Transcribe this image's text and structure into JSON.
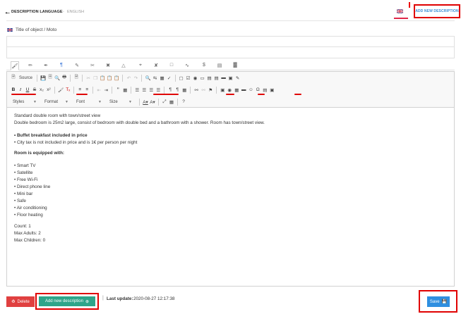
{
  "header": {
    "back_icon": "arrow-left-icon",
    "title": "DESCRIPTION LANGUAGE",
    "separator": "-",
    "language": "ENGLISH",
    "flag_icon": "uk-flag-icon",
    "add_new_label": "ADD NEW DESCRIPTION"
  },
  "title_field": {
    "label": "Title of object / Moto",
    "value": ""
  },
  "tabs": [
    {
      "icon": "paint-brush-icon",
      "active": true
    },
    {
      "icon": "pencil-icon"
    },
    {
      "icon": "pen-icon"
    },
    {
      "icon": "paragraph-icon"
    },
    {
      "icon": "marker-icon"
    },
    {
      "icon": "scissors-icon"
    },
    {
      "icon": "text-format-icon"
    },
    {
      "icon": "crop-icon"
    },
    {
      "icon": "draw-icon"
    },
    {
      "icon": "ruler-icon"
    },
    {
      "icon": "dollar-icon"
    },
    {
      "icon": "bed-icon"
    },
    {
      "icon": "align-icon"
    }
  ],
  "toolbar": {
    "source_label": "Source",
    "styles_label": "Styles",
    "format_label": "Format",
    "font_label": "Font",
    "size_label": "Size",
    "help_label": "?"
  },
  "content": {
    "line1": "Standard double room with town/street view",
    "line2": "Double bedroom is 25m2 large, consist of bedroom with double bed and a bathroom with a shower. Room has town/street view.",
    "breakfast": "• Buffet breakfast included in price",
    "citytax": "• City tax is not included in price and is 1€ per person per night",
    "equipped": "Room is equipped with:",
    "items": [
      "• Smart TV",
      "• Satellite",
      "• Free Wi-Fi",
      "• Direct phone line",
      "• Mini bar",
      "• Safe",
      "• Air conditioning",
      "• Floor heating"
    ],
    "count": "Count: 1",
    "max_adults": "Max Adults: 2",
    "max_children": "Max Children: 0"
  },
  "footer": {
    "delete_label": "Delete",
    "add_new_label": "Add new description",
    "separator": "|",
    "last_update_label": "Last update:",
    "last_update_value": "2020-08-27 12:17:38",
    "save_label": "Save"
  },
  "colors": {
    "highlight": "#e00000",
    "delete": "#e04040",
    "add": "#2ea58a",
    "save": "#2f8fe0",
    "link": "#3a8ed6"
  }
}
